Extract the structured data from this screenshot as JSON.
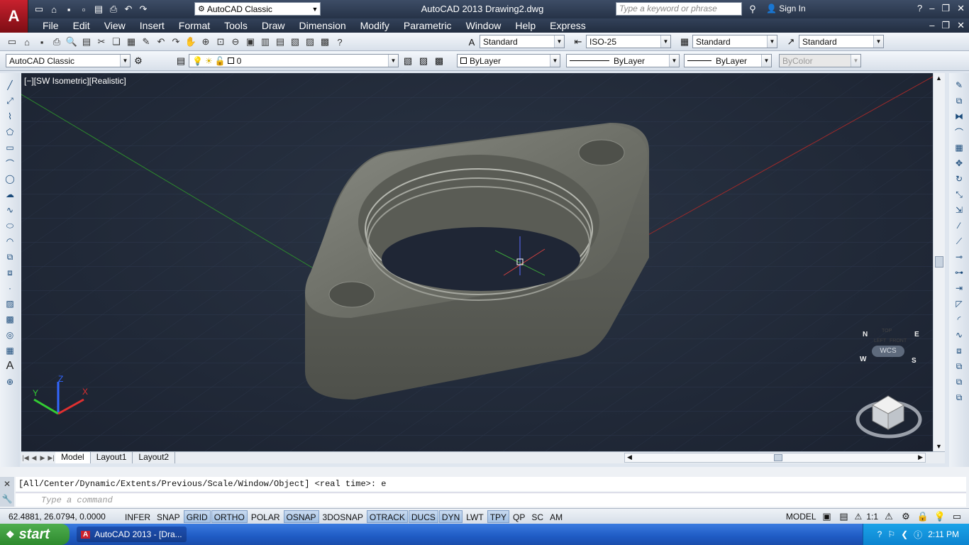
{
  "title_bar": {
    "app_icon_letter": "A",
    "workspace": "AutoCAD Classic",
    "title": "AutoCAD 2013    Drawing2.dwg",
    "search_placeholder": "Type a keyword or phrase",
    "sign_in": "Sign In"
  },
  "menu": [
    "File",
    "Edit",
    "View",
    "Insert",
    "Format",
    "Tools",
    "Draw",
    "Dimension",
    "Modify",
    "Parametric",
    "Window",
    "Help",
    "Express"
  ],
  "toolbar1": {
    "text_style": "Standard",
    "dim_style": "ISO-25",
    "table_style": "Standard",
    "multileader_style": "Standard"
  },
  "toolbar2": {
    "workspace": "AutoCAD Classic",
    "layer": "0",
    "color": "ByLayer",
    "linetype": "ByLayer",
    "lineweight": "ByLayer",
    "plotstyle": "ByColor"
  },
  "viewport": {
    "label": "[−][SW Isometric][Realistic]",
    "wcs": "WCS",
    "viewcube": {
      "top": "TOP",
      "left": "LEFT",
      "front": "FRONT",
      "compass": [
        "N",
        "E",
        "W",
        "S"
      ]
    },
    "axes": {
      "x": "X",
      "y": "Y",
      "z": "Z"
    }
  },
  "layout_tabs": [
    "Model",
    "Layout1",
    "Layout2"
  ],
  "command": {
    "history": "[All/Center/Dynamic/Extents/Previous/Scale/Window/Object] <real time>: e",
    "placeholder": "Type a command"
  },
  "status": {
    "coords": "62.4881, 26.0794, 0.0000",
    "toggles": [
      {
        "label": "INFER",
        "on": false
      },
      {
        "label": "SNAP",
        "on": false
      },
      {
        "label": "GRID",
        "on": true
      },
      {
        "label": "ORTHO",
        "on": true
      },
      {
        "label": "POLAR",
        "on": false
      },
      {
        "label": "OSNAP",
        "on": true
      },
      {
        "label": "3DOSNAP",
        "on": false
      },
      {
        "label": "OTRACK",
        "on": true
      },
      {
        "label": "DUCS",
        "on": true
      },
      {
        "label": "DYN",
        "on": true
      },
      {
        "label": "LWT",
        "on": false
      },
      {
        "label": "TPY",
        "on": true
      },
      {
        "label": "QP",
        "on": false
      },
      {
        "label": "SC",
        "on": false
      },
      {
        "label": "AM",
        "on": false
      }
    ],
    "model": "MODEL",
    "scale": "1:1"
  },
  "taskbar": {
    "start": "start",
    "task": "AutoCAD 2013 - [Dra...",
    "time": "2:11 PM"
  }
}
